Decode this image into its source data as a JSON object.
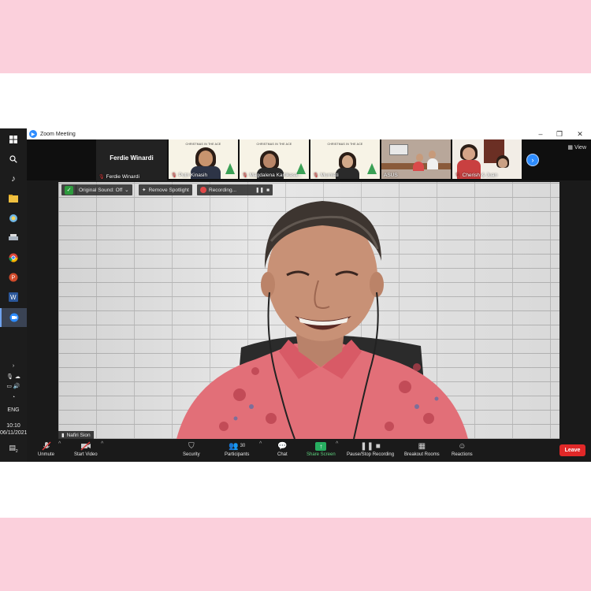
{
  "window": {
    "title": "Zoom Meeting"
  },
  "gallery": {
    "self_display_name": "Ferdie Winardi",
    "self_label": "Ferdie Winardi",
    "slide_banner": "CHRISTMAS IN THE ACE",
    "tiles": [
      {
        "name": "Putri Kinasih"
      },
      {
        "name": "Magdalena Kartikasa..."
      },
      {
        "name": "Murniati"
      },
      {
        "name": "ASUS"
      },
      {
        "name": "Cherish & Juan"
      }
    ],
    "view_label": "View"
  },
  "video_controls": {
    "original_sound": "Original Sound: Off",
    "remove_spotlight": "Remove Spotlight",
    "recording": "Recording..."
  },
  "main_video": {
    "speaker_name": "Nafiri Sion"
  },
  "toolbar": {
    "unmute": "Unmute",
    "start_video": "Start Video",
    "security": "Security",
    "participants": "Participants",
    "participants_count": "30",
    "chat": "Chat",
    "share_screen": "Share Screen",
    "pause_stop_recording": "Pause/Stop Recording",
    "breakout_rooms": "Breakout Rooms",
    "reactions": "Reactions",
    "leave": "Leave"
  },
  "taskbar": {
    "language": "ENG",
    "time": "10:10",
    "date": "06/11/2021",
    "notification_count": "2"
  },
  "colors": {
    "pink_background": "#fbd0dc",
    "zoom_blue": "#2d8cff",
    "leave_red": "#e02828",
    "share_green": "#27ae60"
  }
}
